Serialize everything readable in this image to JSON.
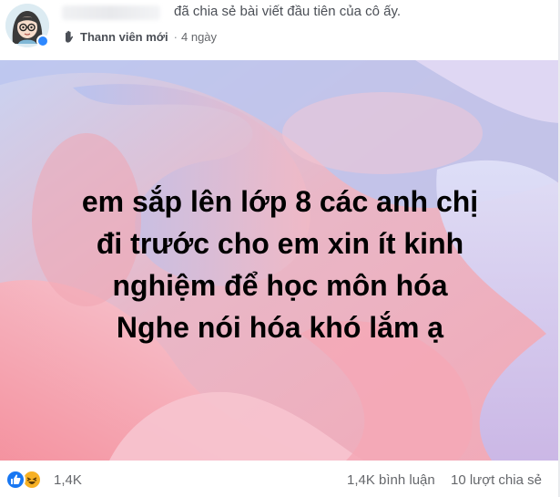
{
  "header": {
    "shared_text": "đã chia sẻ bài viết đầu tiên của cô ấy.",
    "member_badge": "Thann viên mới",
    "separator": "·",
    "time": "4 ngày",
    "icons": {
      "avatar": "avatar-girl-glasses",
      "badge": "wave-hand-icon"
    }
  },
  "image": {
    "lines": [
      "em sắp lên lớp 8 các anh chị",
      "đi trước cho em xin ít kinh",
      "nghiệm để học môn hóa",
      "Nghe nói hóa khó lắm ạ"
    ]
  },
  "footer": {
    "reaction_count": "1,4K",
    "comments": "1,4K bình luận",
    "shares": "10 lượt chia sẻ",
    "icons": {
      "like": "like-icon",
      "haha": "haha-icon"
    }
  },
  "colors": {
    "like_blue": "#1877f2",
    "haha_yellow": "#f7b125",
    "meta_text": "#65676b"
  }
}
